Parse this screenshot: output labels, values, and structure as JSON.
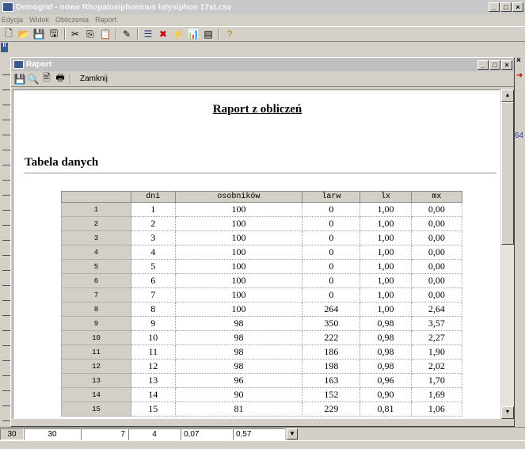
{
  "app": {
    "title": "Demograf - nowe Rhopalosiphoninus latysiphon 17st.csv",
    "win_minimize": "_",
    "win_maximize": "□",
    "win_close": "×"
  },
  "menu": [
    {
      "label": "Edycja"
    },
    {
      "label": "Widok"
    },
    {
      "label": "Obliczenia"
    },
    {
      "label": "Raport"
    }
  ],
  "toolbar_icons": [
    "new-file-icon",
    "open-folder-icon",
    "save-icon",
    "save-all-icon",
    "cut-icon",
    "copy-icon",
    "paste-icon",
    "edit-icon",
    "table-icon",
    "delete-icon",
    "calculate-icon",
    "chart-icon",
    "report-icon",
    "help-icon"
  ],
  "left_strip": {
    "badge": "II"
  },
  "right_side": {
    "close_glyph": "×",
    "arrow_glyph": "➔",
    "number": "64"
  },
  "raport_window": {
    "title": "Raport",
    "toolbar_close_label": "Zamknij",
    "win_minimize": "_",
    "win_maximize": "□",
    "win_close": "×"
  },
  "report": {
    "heading": "Raport z obliczeń",
    "section": "Tabela danych",
    "columns": [
      "",
      "dni",
      "osobników",
      "larw",
      "lx",
      "mx"
    ],
    "rows": [
      [
        "1",
        "1",
        "100",
        "0",
        "1,00",
        "0,00"
      ],
      [
        "2",
        "2",
        "100",
        "0",
        "1,00",
        "0,00"
      ],
      [
        "3",
        "3",
        "100",
        "0",
        "1,00",
        "0,00"
      ],
      [
        "4",
        "4",
        "100",
        "0",
        "1,00",
        "0,00"
      ],
      [
        "5",
        "5",
        "100",
        "0",
        "1,00",
        "0,00"
      ],
      [
        "6",
        "6",
        "100",
        "0",
        "1,00",
        "0,00"
      ],
      [
        "7",
        "7",
        "100",
        "0",
        "1,00",
        "0,00"
      ],
      [
        "8",
        "8",
        "100",
        "264",
        "1,00",
        "2,64"
      ],
      [
        "9",
        "9",
        "98",
        "350",
        "0,98",
        "3,57"
      ],
      [
        "10",
        "10",
        "98",
        "222",
        "0,98",
        "2,27"
      ],
      [
        "11",
        "11",
        "98",
        "186",
        "0,98",
        "1,90"
      ],
      [
        "12",
        "12",
        "98",
        "198",
        "0,98",
        "2,02"
      ],
      [
        "13",
        "13",
        "96",
        "163",
        "0,96",
        "1,70"
      ],
      [
        "14",
        "14",
        "90",
        "152",
        "0,90",
        "1,69"
      ],
      [
        "15",
        "15",
        "81",
        "229",
        "0,81",
        "1,06"
      ]
    ]
  },
  "status": {
    "cells": [
      "30",
      "30",
      "7",
      "4",
      "0,07",
      "0,57"
    ]
  }
}
